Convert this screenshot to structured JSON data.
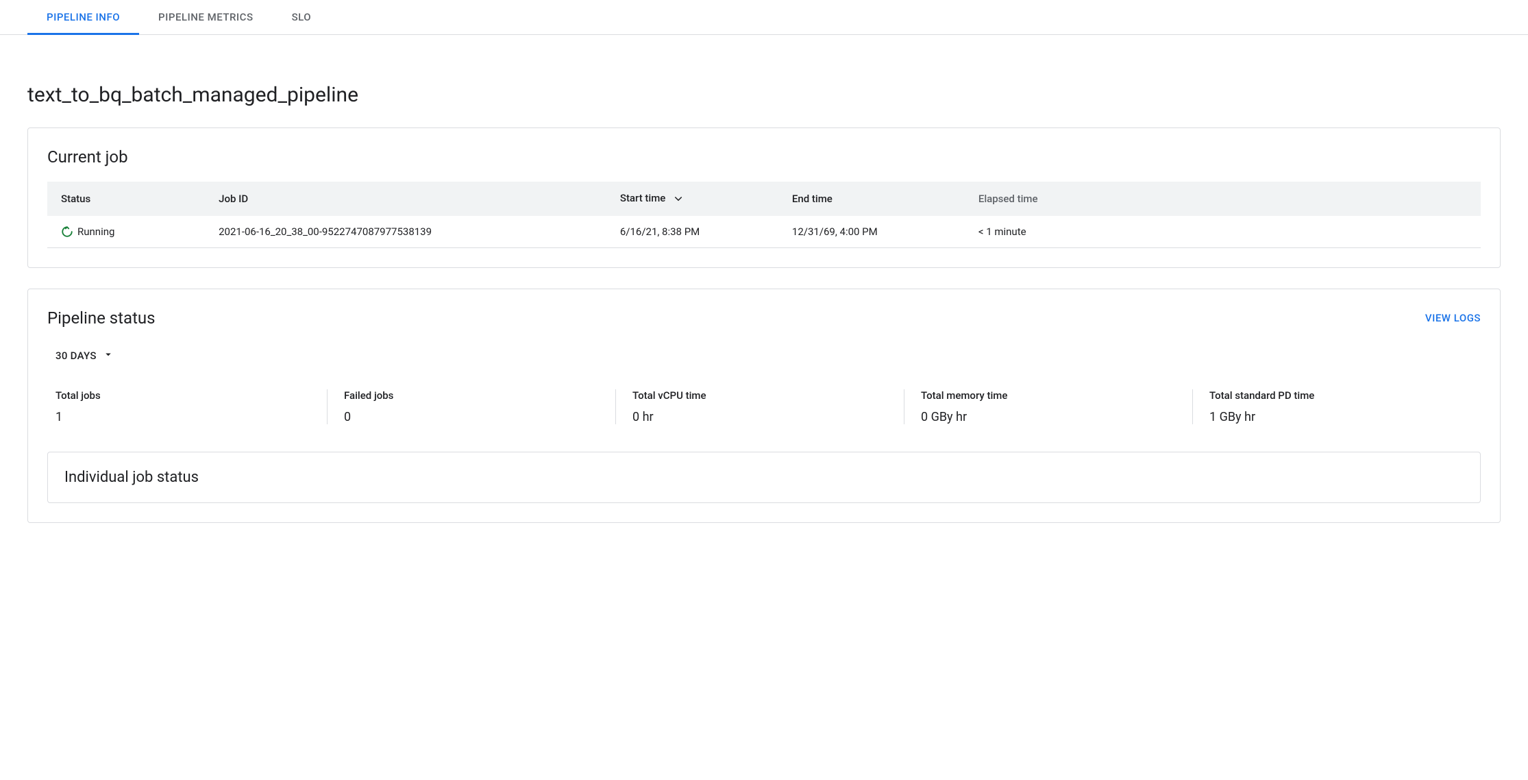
{
  "tabs": {
    "pipeline_info": "PIPELINE INFO",
    "pipeline_metrics": "PIPELINE METRICS",
    "slo": "SLO"
  },
  "page_title": "text_to_bq_batch_managed_pipeline",
  "current_job": {
    "title": "Current job",
    "headers": {
      "status": "Status",
      "job_id": "Job ID",
      "start_time": "Start time",
      "end_time": "End time",
      "elapsed_time": "Elapsed time"
    },
    "row": {
      "status": "Running",
      "job_id": "2021-06-16_20_38_00-9522747087977538139",
      "start_time": "6/16/21, 8:38 PM",
      "end_time": "12/31/69, 4:00 PM",
      "elapsed_time": "< 1 minute"
    }
  },
  "pipeline_status": {
    "title": "Pipeline status",
    "view_logs": "VIEW LOGS",
    "range": "30 DAYS",
    "stats": {
      "total_jobs": {
        "label": "Total jobs",
        "value": "1"
      },
      "failed_jobs": {
        "label": "Failed jobs",
        "value": "0"
      },
      "total_vcpu": {
        "label": "Total vCPU time",
        "value": "0 hr"
      },
      "total_memory": {
        "label": "Total memory time",
        "value": "0 GBy hr"
      },
      "total_pd": {
        "label": "Total standard PD time",
        "value": "1 GBy hr"
      }
    },
    "individual_title": "Individual job status"
  }
}
